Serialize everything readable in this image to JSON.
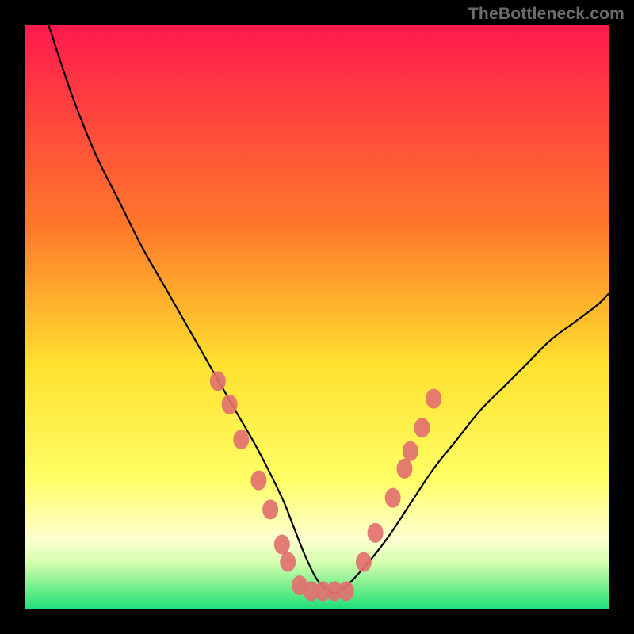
{
  "watermark": "TheBottleneck.com",
  "chart_data": {
    "type": "line",
    "title": "",
    "xlabel": "",
    "ylabel": "",
    "xlim": [
      0,
      100
    ],
    "ylim": [
      0,
      100
    ],
    "grid": false,
    "legend": false,
    "gradient_stops": [
      {
        "offset": 0,
        "color": "#ff1a4d"
      },
      {
        "offset": 35,
        "color": "#ff7a2a"
      },
      {
        "offset": 58,
        "color": "#ffe02e"
      },
      {
        "offset": 78,
        "color": "#ffff66"
      },
      {
        "offset": 88,
        "color": "#fdffd0"
      },
      {
        "offset": 92,
        "color": "#d8ffb0"
      },
      {
        "offset": 96,
        "color": "#7cf08d"
      },
      {
        "offset": 100,
        "color": "#20e07a"
      }
    ],
    "series": [
      {
        "name": "bottleneck-curve",
        "color": "#000000",
        "x": [
          4,
          8,
          12,
          16,
          20,
          24,
          28,
          32,
          36,
          40,
          44,
          46,
          48,
          50,
          52,
          54,
          58,
          62,
          66,
          70,
          74,
          78,
          82,
          86,
          90,
          94,
          98,
          100
        ],
        "y": [
          100,
          88,
          78,
          70,
          62,
          55,
          48,
          41,
          34,
          27,
          19,
          14,
          9,
          5,
          3,
          3,
          7,
          12,
          18,
          24,
          29,
          34,
          38,
          42,
          46,
          49,
          52,
          54
        ]
      }
    ],
    "markers": {
      "name": "sample-points",
      "color": "#e2716f",
      "radius": 10,
      "points": [
        {
          "x": 33,
          "y": 39
        },
        {
          "x": 35,
          "y": 35
        },
        {
          "x": 37,
          "y": 29
        },
        {
          "x": 40,
          "y": 22
        },
        {
          "x": 42,
          "y": 17
        },
        {
          "x": 44,
          "y": 11
        },
        {
          "x": 45,
          "y": 8
        },
        {
          "x": 47,
          "y": 4
        },
        {
          "x": 49,
          "y": 3
        },
        {
          "x": 51,
          "y": 3
        },
        {
          "x": 53,
          "y": 3
        },
        {
          "x": 55,
          "y": 3
        },
        {
          "x": 58,
          "y": 8
        },
        {
          "x": 60,
          "y": 13
        },
        {
          "x": 63,
          "y": 19
        },
        {
          "x": 65,
          "y": 24
        },
        {
          "x": 66,
          "y": 27
        },
        {
          "x": 68,
          "y": 31
        },
        {
          "x": 70,
          "y": 36
        }
      ]
    }
  }
}
